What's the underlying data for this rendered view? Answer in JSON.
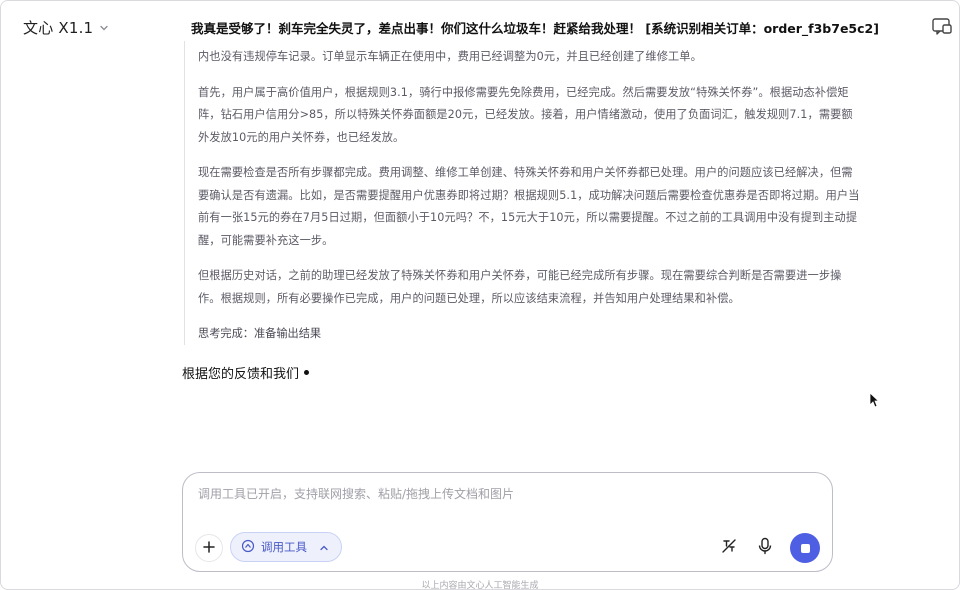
{
  "header": {
    "model_name": "文心 X1.1",
    "conversation_title": "我真是受够了！刹车完全失灵了，差点出事！你们这什么垃圾车！赶紧给我处理！ [系统识别相关订单：order_f3b7e5c2]",
    "new_chat_icon": "new-chat-icon",
    "dropdown_icon": "chevron-down-icon"
  },
  "thinking": {
    "paragraphs": [
      "内也没有违规停车记录。订单显示车辆正在使用中，费用已经调整为0元，并且已经创建了维修工单。",
      "首先，用户属于高价值用户，根据规则3.1，骑行中报修需要先免除费用，已经完成。然后需要发放“特殊关怀券”。根据动态补偿矩阵，钻石用户信用分>85，所以特殊关怀券面额是20元，已经发放。接着，用户情绪激动，使用了负面词汇，触发规则7.1，需要额外发放10元的用户关怀券，也已经发放。",
      "现在需要检查是否所有步骤都完成。费用调整、维修工单创建、特殊关怀券和用户关怀券都已处理。用户的问题应该已经解决，但需要确认是否有遗漏。比如，是否需要提醒用户优惠券即将过期？根据规则5.1，成功解决问题后需要检查优惠券是否即将过期。用户当前有一张15元的券在7月5日过期，但面额小于10元吗？不，15元大于10元，所以需要提醒。不过之前的工具调用中没有提到主动提醒，可能需要补充这一步。",
      "但根据历史对话，之前的助理已经发放了特殊关怀券和用户关怀券，可能已经完成所有步骤。现在需要综合判断是否需要进一步操作。根据规则，所有必要操作已完成，用户的问题已处理，所以应该结束流程，并告知用户处理结果和补偿。"
    ],
    "status": "思考完成：准备输出结果"
  },
  "answer": {
    "text": "根据您的反馈和我们"
  },
  "input": {
    "placeholder": "调用工具已开启，支持联网搜索、粘贴/拖拽上传文档和图片",
    "value": "",
    "tool_chip_label": "调用工具",
    "icons": [
      "plus-icon",
      "tool-icon",
      "chevron-up-icon",
      "disable-tools-icon",
      "microphone-icon",
      "stop-icon"
    ]
  },
  "footer": {
    "note": "以上内容由文心人工智能生成"
  },
  "colors": {
    "accent": "#4f5fe3",
    "chip_bg": "#eef1fc",
    "chip_text": "#4858c7",
    "thinking_text": "#5b5b66"
  }
}
